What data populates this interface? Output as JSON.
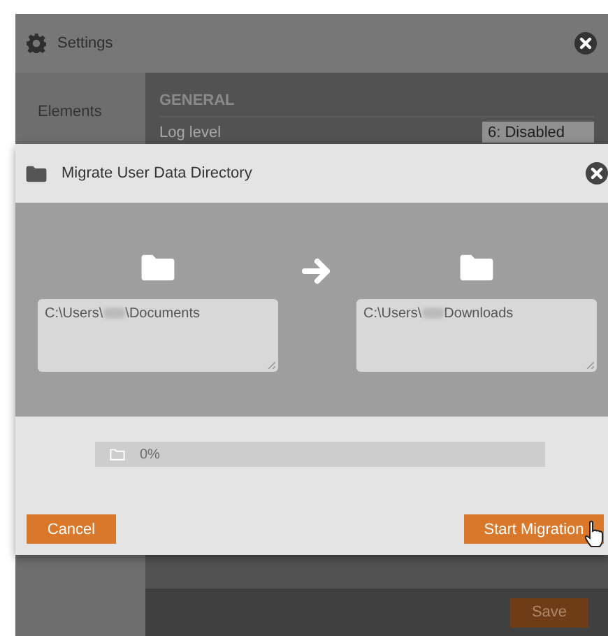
{
  "settings_window": {
    "title": "Settings",
    "sidebar": {
      "items": [
        {
          "label": "Elements",
          "selected": false
        }
      ]
    },
    "section_title": "GENERAL",
    "log_level": {
      "label": "Log level",
      "value": "6: Disabled"
    },
    "save_button": "Save"
  },
  "dialog": {
    "title": "Migrate User Data Directory",
    "source": {
      "path_start": "C:\\Users\\",
      "path_end": "\\Documents"
    },
    "target": {
      "path_start": "C:\\Users\\",
      "path_end": "Downloads"
    },
    "progress": {
      "label": "0%",
      "level": 0
    },
    "buttons": {
      "cancel": "Cancel",
      "start": "Start Migration"
    }
  }
}
